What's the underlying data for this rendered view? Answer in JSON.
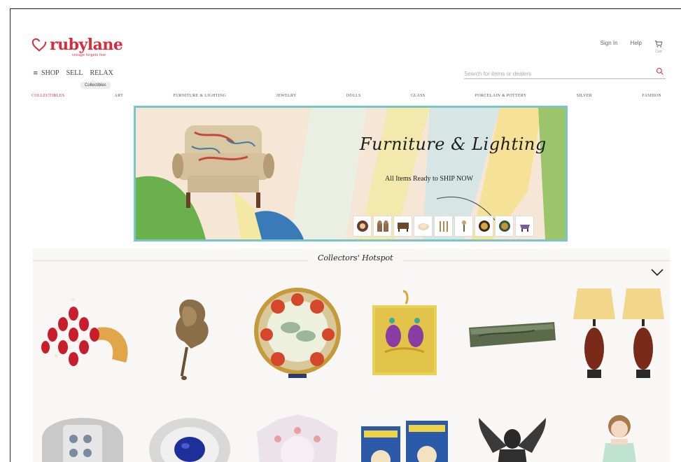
{
  "header": {
    "logo_text": "rubylane",
    "logo_tagline": "vintage forgets fine",
    "sign_in": "Sign In",
    "help": "Help",
    "cart_count": "Cart"
  },
  "nav": {
    "menu_icon": "≡",
    "shop": "SHOP",
    "sell": "SELL",
    "relax": "RELAX",
    "tooltip": "Collectibles"
  },
  "search": {
    "placeholder": "Search for items or dealers",
    "icon": "search-icon"
  },
  "categories": [
    "COLLECTIBLES",
    "ART",
    "FURNITURE & LIGHTING",
    "JEWELRY",
    "DOLLS",
    "GLASS",
    "PORCELAIN & POTTERY",
    "SILVER",
    "FASHION"
  ],
  "banner": {
    "title": "Furniture & Lighting",
    "subtitle": "All Items Ready to SHIP NOW"
  },
  "hotspot": {
    "title": "Collectors' Hotspot"
  },
  "colors": {
    "brand_red": "#d92b3a",
    "banner_border": "#7ac5c7"
  }
}
